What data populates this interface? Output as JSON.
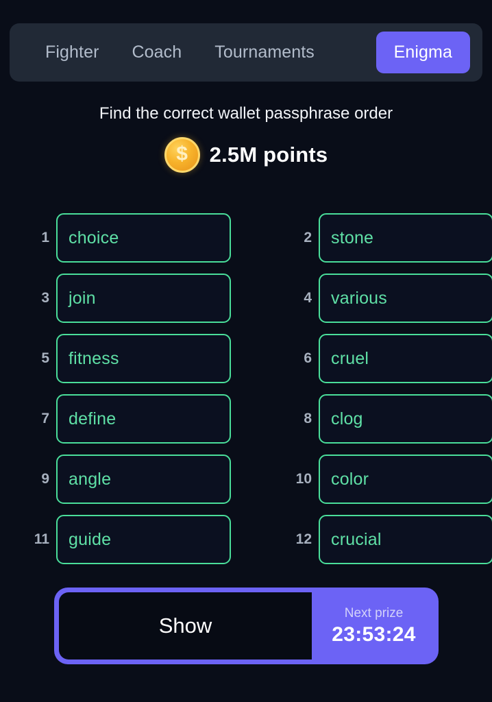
{
  "nav": {
    "tabs": [
      {
        "label": "Fighter",
        "active": false
      },
      {
        "label": "Coach",
        "active": false
      },
      {
        "label": "Tournaments",
        "active": false
      },
      {
        "label": "Enigma",
        "active": true
      }
    ]
  },
  "header": {
    "subtitle": "Find the correct wallet passphrase order",
    "coin_icon": "coin-dollar-icon",
    "coin_symbol": "$",
    "points": "2.5M points"
  },
  "puzzle": {
    "words": [
      {
        "index": "1",
        "word": "choice"
      },
      {
        "index": "2",
        "word": "stone"
      },
      {
        "index": "3",
        "word": "join"
      },
      {
        "index": "4",
        "word": "various"
      },
      {
        "index": "5",
        "word": "fitness"
      },
      {
        "index": "6",
        "word": "cruel"
      },
      {
        "index": "7",
        "word": "define"
      },
      {
        "index": "8",
        "word": "clog"
      },
      {
        "index": "9",
        "word": "angle"
      },
      {
        "index": "10",
        "word": "color"
      },
      {
        "index": "11",
        "word": "guide"
      },
      {
        "index": "12",
        "word": "crucial"
      }
    ]
  },
  "actions": {
    "show_label": "Show",
    "prize_label": "Next prize",
    "prize_timer": "23:53:24"
  },
  "colors": {
    "background": "#090D18",
    "navbar": "#212936",
    "accent_purple": "#6C63F5",
    "word_border_green": "#4ADE9A",
    "word_text_green": "#5FE0A6",
    "coin_gold": "#F7B32B"
  }
}
